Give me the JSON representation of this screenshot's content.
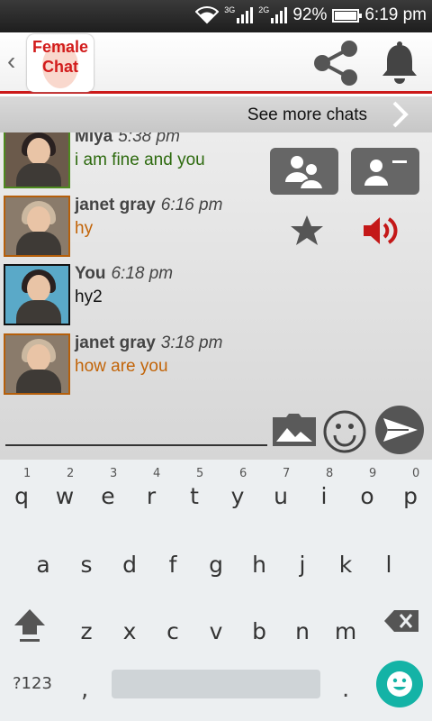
{
  "status_bar": {
    "net1": "3G",
    "net2": "2G",
    "battery": "92%",
    "time": "6:19 pm"
  },
  "app_bar": {
    "logo_line1": "Female",
    "logo_line2": "Chat",
    "share_icon": "share-icon",
    "bell_icon": "bell-icon"
  },
  "see_more": {
    "label": "See more chats"
  },
  "messages": [
    {
      "sender": "Miya",
      "time": "5:38 pm",
      "text": "i am fine and you",
      "color": "#2d6a0e"
    },
    {
      "sender": "janet gray",
      "time": "6:16 pm",
      "text": "hy",
      "color": "#c26408"
    },
    {
      "sender": "You",
      "time": "6:18 pm",
      "text": "hy2",
      "color": "#111111"
    },
    {
      "sender": "janet gray",
      "time": "3:18 pm",
      "text": "how are you",
      "color": "#c26408"
    }
  ],
  "keyboard": {
    "row1": [
      {
        "char": "q",
        "hint": "1"
      },
      {
        "char": "w",
        "hint": "2"
      },
      {
        "char": "e",
        "hint": "3"
      },
      {
        "char": "r",
        "hint": "4"
      },
      {
        "char": "t",
        "hint": "5"
      },
      {
        "char": "y",
        "hint": "6"
      },
      {
        "char": "u",
        "hint": "7"
      },
      {
        "char": "i",
        "hint": "8"
      },
      {
        "char": "o",
        "hint": "9"
      },
      {
        "char": "p",
        "hint": "0"
      }
    ],
    "row2": [
      "a",
      "s",
      "d",
      "f",
      "g",
      "h",
      "j",
      "k",
      "l"
    ],
    "row3": [
      "z",
      "x",
      "c",
      "v",
      "b",
      "n",
      "m"
    ],
    "symbols": "?123",
    "comma": ",",
    "period": "."
  },
  "colors": {
    "accent": "#cc1a1a",
    "keyboard_bg": "#eceff1",
    "emoji_key": "#14b3a6"
  }
}
